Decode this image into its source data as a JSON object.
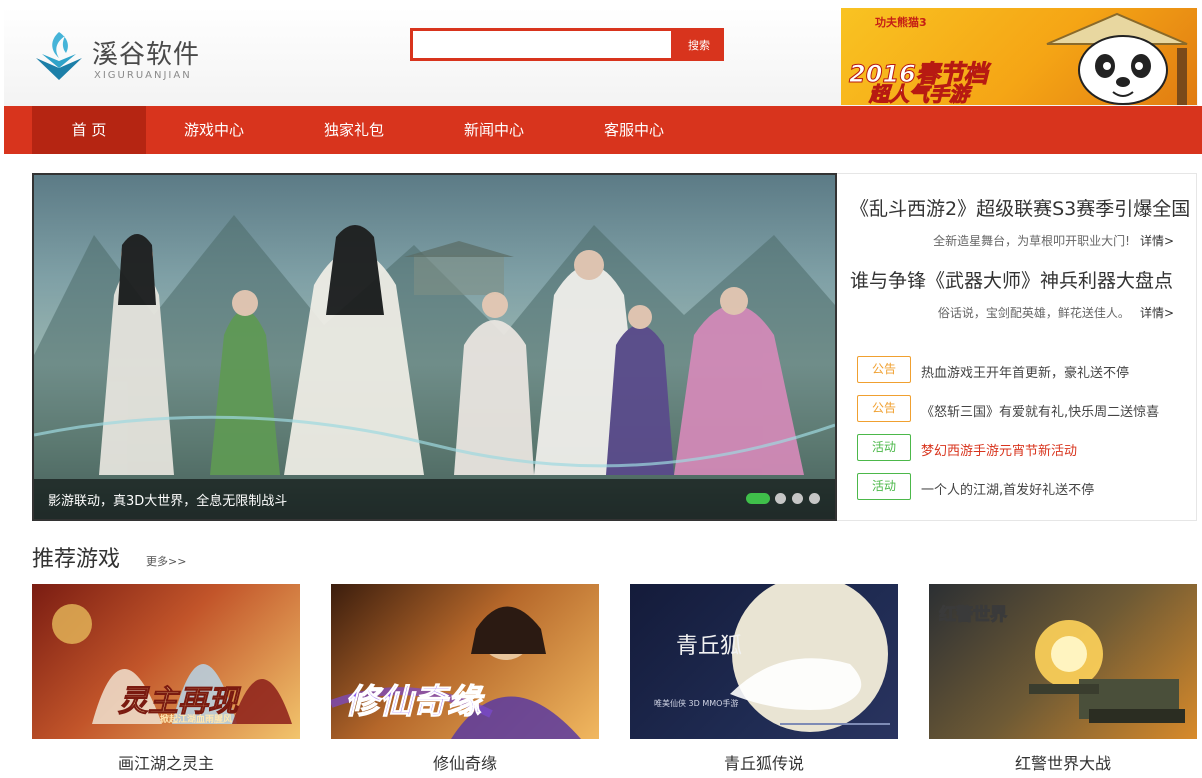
{
  "header": {
    "logo_name": "溪谷软件",
    "logo_sub": "XIGURUANJIAN",
    "search_placeholder": "",
    "search_button": "搜索",
    "ad": {
      "small": "功夫熊猫3",
      "line1": "2016春节档",
      "line2": "超人气手游"
    }
  },
  "nav": {
    "items": [
      {
        "label": "首 页",
        "active": true
      },
      {
        "label": "游戏中心"
      },
      {
        "label": "独家礼包"
      },
      {
        "label": "新闻中心"
      },
      {
        "label": "客服中心"
      }
    ]
  },
  "hero": {
    "caption": "影游联动，真3D大世界，全息无限制战斗",
    "slides_count": 4,
    "active_slide": 1
  },
  "news": {
    "headlines": [
      {
        "title": "《乱斗西游2》超级联赛S3赛季引爆全国",
        "summary": "全新造星舞台，为草根叩开职业大门!",
        "more": "详情>"
      },
      {
        "title": "谁与争锋《武器大师》神兵利器大盘点",
        "summary": "俗话说，宝剑配英雄，鲜花送佳人。",
        "more": "详情>"
      }
    ],
    "notices": [
      {
        "tag": "公告",
        "text": "热血游戏王开年首更新，豪礼送不停"
      },
      {
        "tag": "公告",
        "text": "《怒斩三国》有爱就有礼,快乐周二送惊喜"
      },
      {
        "tag": "活动",
        "text": "梦幻西游手游元宵节新活动"
      },
      {
        "tag": "活动",
        "text": "一个人的江湖,首发好礼送不停"
      }
    ]
  },
  "recommended": {
    "title": "推荐游戏",
    "more": "更多>>",
    "games": [
      {
        "name": "画江湖之灵主",
        "logo": "灵主再现",
        "sub": "掀起江湖血雨腥风"
      },
      {
        "name": "修仙奇缘",
        "logo": "修仙奇缘"
      },
      {
        "name": "青丘狐传说",
        "logo": "青丘狐",
        "sub": "唯美仙侠 3D MMO手游"
      },
      {
        "name": "红警世界大战",
        "logo": "红警世界"
      }
    ]
  },
  "colors": {
    "brand_red": "#d8341d",
    "nav_active": "#b52512",
    "notice": "#f0a030",
    "event": "#4cb84a"
  }
}
